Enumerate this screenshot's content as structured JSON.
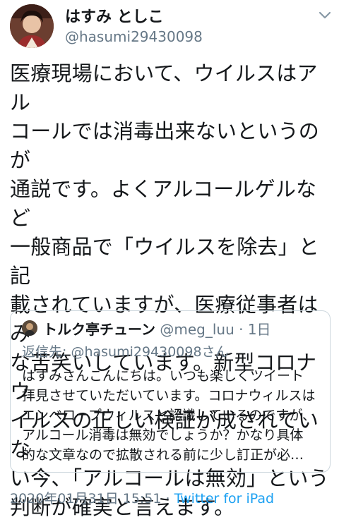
{
  "tweet": {
    "display_name": "はすみ としこ",
    "handle": "@hasumi29430098",
    "body": "医療現場において、ウイルスはアル\nコールでは消毒出来ないというのが\n通説です。よくアルコールゲルなど\n一般商品で「ウイルスを除去」と記\n載されていますが、医療従事者はみ\nな苦笑いしています。新型コロナウ\nイルスの正しい検証が成されていな\nい今、「アルコールは無効」という\n判断が確実と言えます。",
    "timestamp": "2020年01月31日 15:51",
    "separator": " · ",
    "source": "Twitter for iPad"
  },
  "quote": {
    "name": "トルク亭チューン",
    "handle": "@meg_luu",
    "meta_sep": " · ",
    "age": "1日",
    "reply_to": "返信先: @hasumi29430098さん",
    "text": "はすみさんこんにちは。いつも楽しくツイート\n拝見させていただいています。コロナウィルスは\nエンベロープウィルスと認識しているのですが、\nアルコール消毒は無効でしょうか？かなり具体\n的な文章なので拡散される前に少し訂正が必…"
  },
  "icons": {
    "caret": "chevron-down-icon",
    "avatar": "user-avatar",
    "quote_avatar": "user-avatar"
  },
  "colors": {
    "text": "#14171a",
    "muted": "#657786",
    "link": "#1da1f2",
    "border": "#ccd6dd"
  }
}
